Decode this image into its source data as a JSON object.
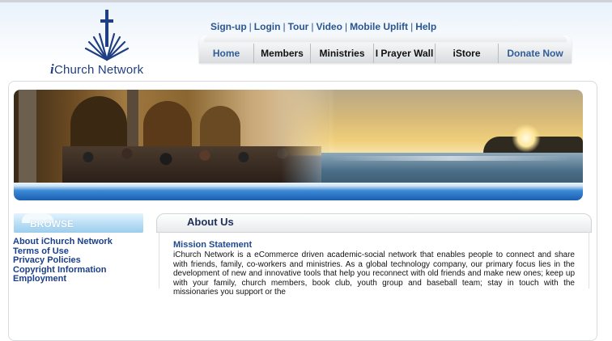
{
  "brand": {
    "prefix": "i",
    "name": "Church Network"
  },
  "top_links": [
    "Sign-up",
    "Login",
    "Tour",
    "Video",
    "Mobile Uplift",
    "Help"
  ],
  "nav": [
    "Home",
    "Members",
    "Ministries",
    "I Prayer Wall",
    "iStore",
    "Donate Now"
  ],
  "sidebar": {
    "title": "BROWSE",
    "links": [
      "About iChurch Network",
      "Terms of Use",
      "Privacy Policies",
      "Copyright Information",
      "Employment"
    ]
  },
  "about": {
    "heading": "About Us",
    "mission_title": "Mission Statement",
    "mission_text": "iChurch Network is a eCommerce driven academic-social network that enables people to connect and share with friends, family, co-workers and ministries. As a global technology company, our primary focus lies in the development of new and innovative tools that help you reconnect with old friends and make new ones; keep up with your family, church members, book club, youth group and baseball team; stay in touch with the missionaries you support or the"
  },
  "colors": {
    "brand": "#1f3f84",
    "link": "#2b5590",
    "accent_bar": "#1a5fb0",
    "browse": "#9ccdec"
  }
}
